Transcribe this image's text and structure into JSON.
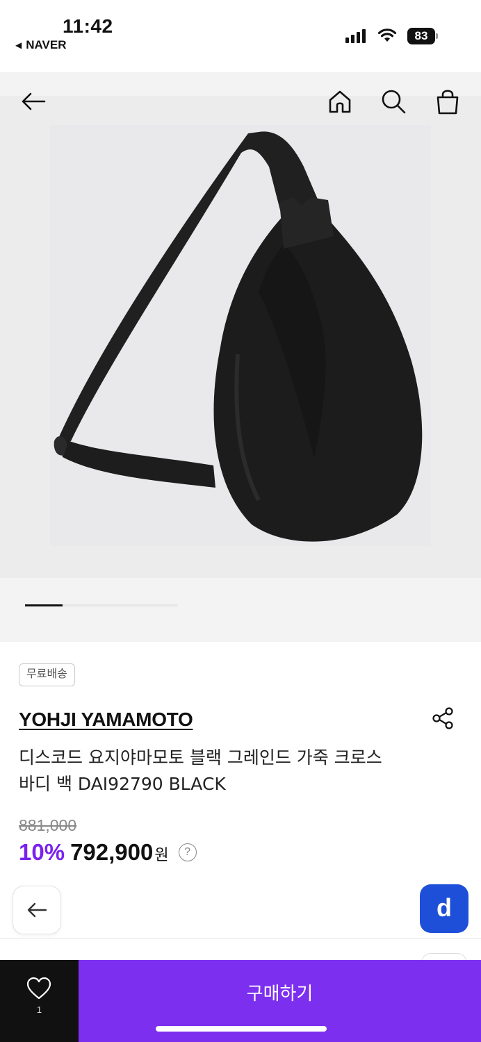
{
  "status_bar": {
    "time": "11:42",
    "back_app": "NAVER",
    "battery": "83"
  },
  "nav": {
    "icons": [
      "back-arrow-icon",
      "home-icon",
      "search-icon",
      "shopping-bag-icon"
    ]
  },
  "product": {
    "image_alt": "black leather sling bag",
    "carousel_position": 1,
    "shipping_badge": "무료배송",
    "brand": "YOHJI YAMAMOTO",
    "title": "디스코드 요지야마모토 블랙 그레인드 가죽 크로스바디 백 DAI92790 BLACK",
    "original_price": "881,000",
    "discount": "10%",
    "price": "792,900",
    "currency": "원",
    "help_symbol": "?"
  },
  "floating": {
    "d_label": "d"
  },
  "bottom_bar": {
    "wish_count": "1",
    "buy_label": "구매하기"
  },
  "colors": {
    "accent": "#7d2ff0",
    "discount": "#7a22ee",
    "d_button": "#1e4fd8"
  }
}
